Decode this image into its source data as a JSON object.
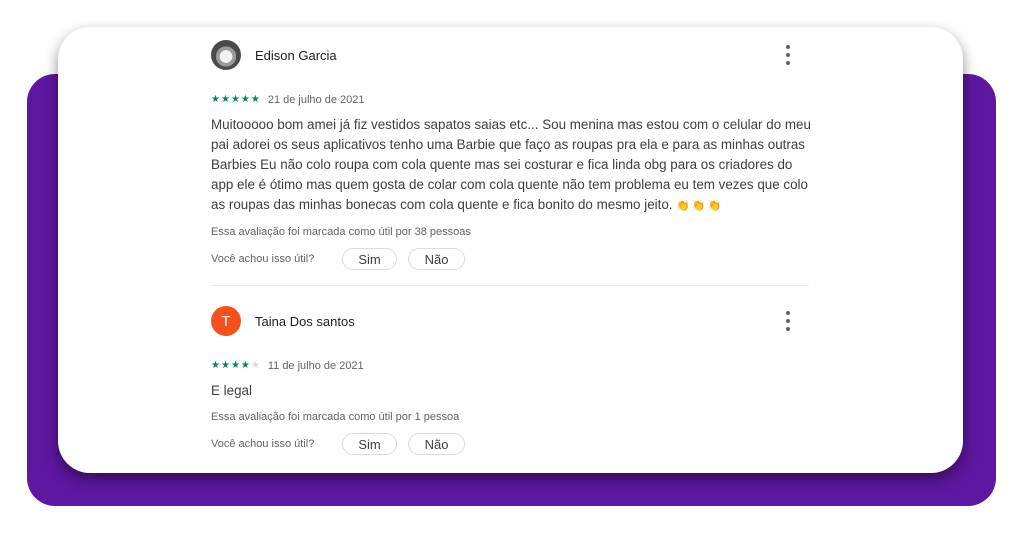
{
  "colors": {
    "accent_purple": "#5e17a0",
    "star_green": "#01875f",
    "avatar_orange": "#f4511e"
  },
  "reviews": [
    {
      "author": "Edison Garcia",
      "avatar_type": "photo",
      "avatar_letter": "",
      "rating": 5,
      "stars": [
        "★",
        "★",
        "★",
        "★",
        "★"
      ],
      "date": "21 de julho de 2021",
      "text": "Muitooooo bom amei já fiz vestidos sapatos saias etc... Sou menina mas estou com o celular do meu pai adorei os seus aplicativos tenho uma Barbie que faço as roupas pra ela e para as minhas outras Barbies Eu não colo roupa com cola quente mas sei costurar e fica linda obg para os criadores do app ele é ótimo mas quem gosta de colar com cola quente não tem problema eu tem vezes que colo as roupas das minhas bonecas com cola quente e fica bonito do mesmo jeito.",
      "emoji": "👏👏👏",
      "helpful_count": "Essa avaliação foi marcada como útil por 38 pessoas",
      "helpful_question": "Você achou isso útil?",
      "yes_label": "Sim",
      "no_label": "Não"
    },
    {
      "author": "Taina Dos santos",
      "avatar_type": "letter",
      "avatar_letter": "T",
      "rating": 4,
      "stars": [
        "★",
        "★",
        "★",
        "★",
        "★"
      ],
      "date": "11 de julho de 2021",
      "text": "E legal",
      "emoji": "",
      "helpful_count": "Essa avaliação foi marcada como útil por 1 pessoa",
      "helpful_question": "Você achou isso útil?",
      "yes_label": "Sim",
      "no_label": "Não"
    }
  ]
}
